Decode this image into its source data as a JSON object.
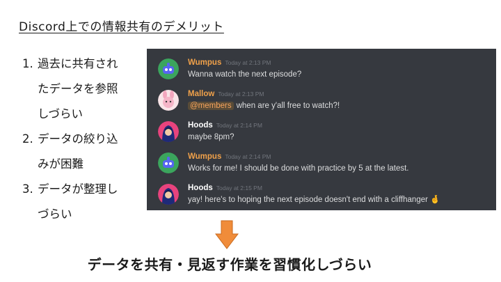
{
  "title": "Discord上での情報共有のデメリット",
  "points": [
    {
      "num": "1.",
      "lines": [
        "過去に共有され",
        "たデータを参照",
        "しづらい"
      ]
    },
    {
      "num": "2.",
      "lines": [
        "データの絞り込",
        "みが困難"
      ]
    },
    {
      "num": "3.",
      "lines": [
        "データが整理し",
        "づらい"
      ]
    }
  ],
  "chat": {
    "background": "#36393f",
    "messages": [
      {
        "author": "Wumpus",
        "author_color": "#f0a14a",
        "time": "Today at 2:13 PM",
        "mention": "",
        "text": "Wanna watch the next episode?",
        "emoji": "",
        "avatar_icon": "wumpus-avatar-icon"
      },
      {
        "author": "Mallow",
        "author_color": "#f0a14a",
        "time": "Today at 2:13 PM",
        "mention": "@members",
        "text": "when are y'all free to watch?!",
        "emoji": "",
        "avatar_icon": "mallow-avatar-icon"
      },
      {
        "author": "Hoods",
        "author_color": "#ffffff",
        "time": "Today at 2:14 PM",
        "mention": "",
        "text": "maybe 8pm?",
        "emoji": "",
        "avatar_icon": "hoods-avatar-icon"
      },
      {
        "author": "Wumpus",
        "author_color": "#f0a14a",
        "time": "Today at 2:14 PM",
        "mention": "",
        "text": "Works for me! I should be done with practice by 5 at the latest.",
        "emoji": "",
        "avatar_icon": "wumpus-avatar-icon"
      },
      {
        "author": "Hoods",
        "author_color": "#ffffff",
        "time": "Today at 2:15 PM",
        "mention": "",
        "text": "yay! here's to hoping the next episode doesn't end with a cliffhanger",
        "emoji": "🤞",
        "avatar_icon": "hoods-avatar-icon"
      }
    ]
  },
  "arrow_color": "#f08c3a",
  "conclusion": "データを共有・見返す作業を習慣化しづらい"
}
